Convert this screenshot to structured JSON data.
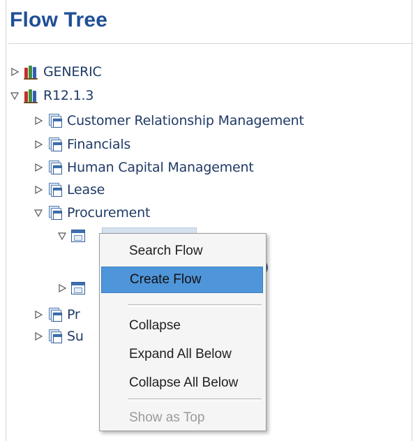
{
  "header": {
    "title": "Flow Tree"
  },
  "tree": {
    "generic": "GENERIC",
    "release": "R12.1.3",
    "crm": "Customer Relationship Management",
    "financials": "Financials",
    "hcm": "Human Capital Management",
    "lease": "Lease",
    "procurement": "Procurement",
    "partial_parenthesis": ")",
    "partial_pr": "Pr",
    "partial_su": "Su"
  },
  "context_menu": {
    "search_flow": "Search Flow",
    "create_flow": "Create Flow",
    "collapse": "Collapse",
    "expand_all_below": "Expand All Below",
    "collapse_all_below": "Collapse All Below",
    "show_as_top": "Show as Top"
  },
  "colors": {
    "title": "#1f4f96",
    "menu_highlight": "#4f95d9",
    "selection": "#d6e2f0"
  }
}
